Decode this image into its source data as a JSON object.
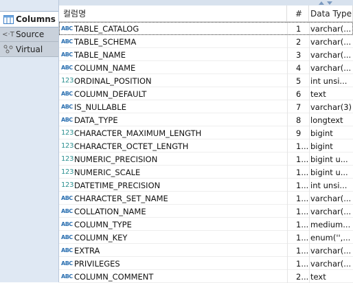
{
  "sidebar": {
    "tabs": [
      {
        "label": "Columns",
        "icon": "columns-icon",
        "active": true
      },
      {
        "label": "Source",
        "icon": "source-icon",
        "active": false
      },
      {
        "label": "Virtual",
        "icon": "virtual-icon",
        "active": false
      }
    ]
  },
  "grid": {
    "headers": {
      "name": "컬럼명",
      "num": "#",
      "type": "Data Type"
    },
    "rows": [
      {
        "icon": "ABC",
        "name": "TABLE_CATALOG",
        "num": "1",
        "type": "varchar(..."
      },
      {
        "icon": "ABC",
        "name": "TABLE_SCHEMA",
        "num": "2",
        "type": "varchar(..."
      },
      {
        "icon": "ABC",
        "name": "TABLE_NAME",
        "num": "3",
        "type": "varchar(..."
      },
      {
        "icon": "ABC",
        "name": "COLUMN_NAME",
        "num": "4",
        "type": "varchar(..."
      },
      {
        "icon": "123",
        "name": "ORDINAL_POSITION",
        "num": "5",
        "type": "int unsi..."
      },
      {
        "icon": "ABC",
        "name": "COLUMN_DEFAULT",
        "num": "6",
        "type": "text"
      },
      {
        "icon": "ABC",
        "name": "IS_NULLABLE",
        "num": "7",
        "type": "varchar(3)"
      },
      {
        "icon": "ABC",
        "name": "DATA_TYPE",
        "num": "8",
        "type": "longtext"
      },
      {
        "icon": "123",
        "name": "CHARACTER_MAXIMUM_LENGTH",
        "num": "9",
        "type": "bigint"
      },
      {
        "icon": "123",
        "name": "CHARACTER_OCTET_LENGTH",
        "num": "1...",
        "type": "bigint"
      },
      {
        "icon": "123",
        "name": "NUMERIC_PRECISION",
        "num": "1...",
        "type": "bigint u..."
      },
      {
        "icon": "123",
        "name": "NUMERIC_SCALE",
        "num": "1...",
        "type": "bigint u..."
      },
      {
        "icon": "123",
        "name": "DATETIME_PRECISION",
        "num": "1...",
        "type": "int unsi..."
      },
      {
        "icon": "ABC",
        "name": "CHARACTER_SET_NAME",
        "num": "1...",
        "type": "varchar(..."
      },
      {
        "icon": "ABC",
        "name": "COLLATION_NAME",
        "num": "1...",
        "type": "varchar(..."
      },
      {
        "icon": "ABC",
        "name": "COLUMN_TYPE",
        "num": "1...",
        "type": "medium..."
      },
      {
        "icon": "ABC",
        "name": "COLUMN_KEY",
        "num": "1...",
        "type": "enum('',..."
      },
      {
        "icon": "ABC",
        "name": "EXTRA",
        "num": "1...",
        "type": "varchar(..."
      },
      {
        "icon": "ABC",
        "name": "PRIVILEGES",
        "num": "1...",
        "type": "varchar(..."
      },
      {
        "icon": "ABC",
        "name": "COLUMN_COMMENT",
        "num": "2...",
        "type": "text"
      }
    ]
  },
  "colors": {
    "text_badge": "#2a6fb0",
    "num_badge": "#2a8f8f",
    "sidebar_bg": "#dfe8f3"
  }
}
